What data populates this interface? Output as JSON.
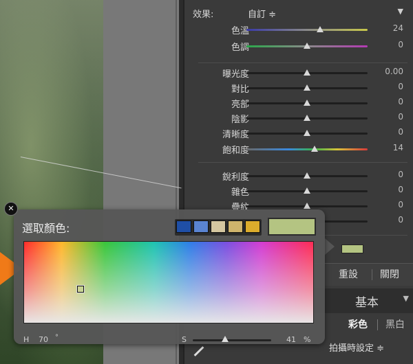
{
  "effects_panel": {
    "effect_label": "效果:",
    "preset_label": "自訂 ≑",
    "collapse_icon": "triangle-down-icon",
    "sliders": [
      {
        "label": "色溫",
        "value": "24",
        "level": 0.61,
        "track": "temp"
      },
      {
        "label": "色調",
        "value": "0",
        "level": 0.5,
        "track": "tint"
      },
      {
        "label": "曝光度",
        "value": "0.00",
        "level": 0.5,
        "track": "plain"
      },
      {
        "label": "對比",
        "value": "0",
        "level": 0.5,
        "track": "plain"
      },
      {
        "label": "亮部",
        "value": "0",
        "level": 0.5,
        "track": "plain"
      },
      {
        "label": "陰影",
        "value": "0",
        "level": 0.5,
        "track": "plain"
      },
      {
        "label": "清晰度",
        "value": "0",
        "level": 0.5,
        "track": "plain"
      },
      {
        "label": "飽和度",
        "value": "14",
        "level": 0.56,
        "track": "sat"
      },
      {
        "label": "銳利度",
        "value": "0",
        "level": 0.5,
        "track": "plain"
      },
      {
        "label": "雜色",
        "value": "0",
        "level": 0.5,
        "track": "plain"
      },
      {
        "label": "疊紋",
        "value": "0",
        "level": 0.5,
        "track": "plain"
      },
      {
        "label": "",
        "value": "0",
        "level": 0.5,
        "track": "plain"
      }
    ],
    "reset_label": "重設",
    "close_label": "關閉",
    "section_title": "基本",
    "color_tab": "彩色",
    "bw_tab": "黑白",
    "wb_label": "拍攝時設定 ≑"
  },
  "color_picker": {
    "title": "選取顏色:",
    "preset_swatches": [
      "#1f4fa6",
      "#5a84d2",
      "#d4c6a0",
      "#cfb46c",
      "#dcac2c"
    ],
    "current_color": "#b4c482",
    "h_label": "H",
    "h_value": "70",
    "h_unit": "°",
    "s_label": "S",
    "s_value": "41",
    "s_unit": "%",
    "s_level": 0.41
  },
  "close_icon_glyph": "✕"
}
